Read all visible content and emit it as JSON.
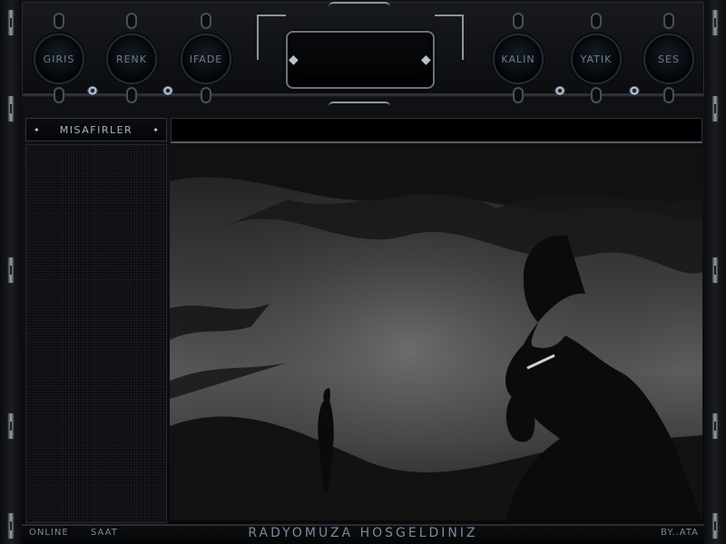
{
  "toolbar": {
    "left_buttons": [
      "GIRIS",
      "RENK",
      "IFADE"
    ],
    "right_buttons": [
      "KALIN",
      "YATIK",
      "SES"
    ]
  },
  "guests": {
    "title": "MISAFIRLER"
  },
  "message_input": {
    "value": ""
  },
  "footer": {
    "online_label": "ONLINE",
    "clock_label": "SAAT",
    "welcome": "RADYOMUZA   HOSGELDINIZ",
    "credit": "BY..ATA"
  },
  "colors": {
    "accent": "#6e7c8f",
    "frame": "#111317",
    "display_border": "#6b7280"
  },
  "icons": [
    "eye-icon",
    "stud-icon",
    "star-icon"
  ]
}
